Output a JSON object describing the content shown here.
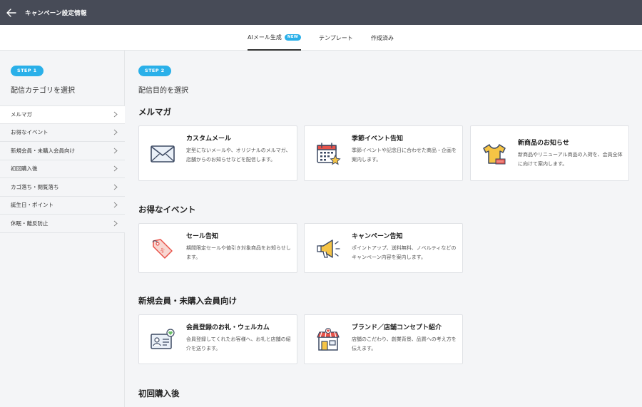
{
  "header": {
    "title": "キャンペーン設定情報"
  },
  "tabs": [
    {
      "label": "AIメール生成",
      "badge": "NEW"
    },
    {
      "label": "テンプレート"
    },
    {
      "label": "作成済み"
    }
  ],
  "sidebar": {
    "step": "STEP 1",
    "title": "配信カテゴリを選択",
    "items": [
      {
        "label": "メルマガ"
      },
      {
        "label": "お得なイベント"
      },
      {
        "label": "新規会員・未購入会員向け"
      },
      {
        "label": "初回購入後"
      },
      {
        "label": "カゴ落ち・閲覧落ち"
      },
      {
        "label": "誕生日・ポイント"
      },
      {
        "label": "休眠・離反防止"
      }
    ]
  },
  "main": {
    "step": "STEP 2",
    "title": "配信目的を選択",
    "sections": [
      {
        "heading": "メルマガ",
        "cards": [
          {
            "title": "カスタムメール",
            "desc": "定型にないメールや、オリジナルのメルマガ、店舗からのお知らせなどを配信します。",
            "icon": "envelope-icon"
          },
          {
            "title": "季節イベント告知",
            "desc": "季節イベントや記念日に合わせた商品・企画を案内します。",
            "icon": "calendar-icon"
          },
          {
            "title": "新商品のお知らせ",
            "desc": "新商品やリニューアル商品の入荷を、会員全体に向けて案内します。",
            "icon": "tshirt-icon"
          }
        ]
      },
      {
        "heading": "お得なイベント",
        "cards": [
          {
            "title": "セール告知",
            "desc": "期間限定セールや値引き対象商品をお知らせします。",
            "icon": "sale-tag-icon"
          },
          {
            "title": "キャンペーン告知",
            "desc": "ポイントアップ、送料無料、ノベルティなどのキャンペーン内容を案内します。",
            "icon": "megaphone-icon"
          }
        ]
      },
      {
        "heading": "新規会員・未購入会員向け",
        "cards": [
          {
            "title": "会員登録のお礼・ウェルカム",
            "desc": "会員登録してくれたお客様へ、お礼と店舗の紹介を送ります。",
            "icon": "member-card-icon"
          },
          {
            "title": "ブランド／店舗コンセプト紹介",
            "desc": "店舗のこだわり、創業背景、品質への考え方を伝えます。",
            "icon": "store-icon"
          }
        ]
      },
      {
        "heading": "初回購入後",
        "cards": []
      }
    ]
  }
}
